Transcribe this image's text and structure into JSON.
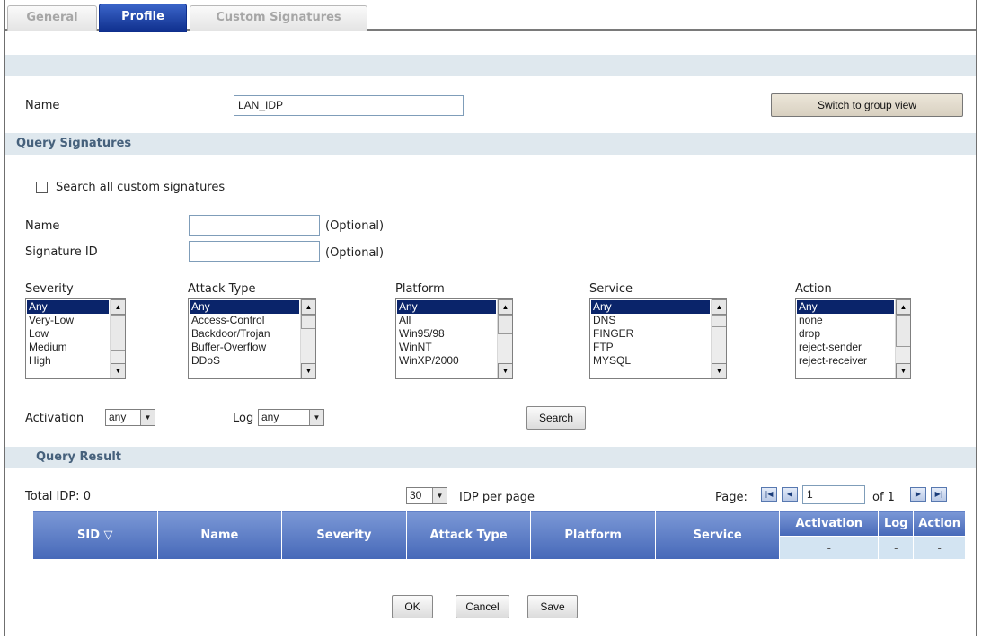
{
  "tabs": [
    {
      "label": "General"
    },
    {
      "label": "Profile"
    },
    {
      "label": "Custom Signatures"
    }
  ],
  "profile": {
    "name_label": "Name",
    "name_value": "LAN_IDP",
    "switch_button": "Switch to group view"
  },
  "query": {
    "header": "Query Signatures",
    "search_all_label": "Search all custom signatures",
    "name_label": "Name",
    "name_optional": "(Optional)",
    "sigid_label": "Signature ID",
    "sigid_optional": "(Optional)",
    "severity": {
      "label": "Severity",
      "options": [
        "Any",
        "Very-Low",
        "Low",
        "Medium",
        "High"
      ]
    },
    "attack_type": {
      "label": "Attack Type",
      "options": [
        "Any",
        "Access-Control",
        "Backdoor/Trojan",
        "Buffer-Overflow",
        "DDoS"
      ]
    },
    "platform": {
      "label": "Platform",
      "options": [
        "Any",
        "All",
        "Win95/98",
        "WinNT",
        "WinXP/2000"
      ]
    },
    "service": {
      "label": "Service",
      "options": [
        "Any",
        "DNS",
        "FINGER",
        "FTP",
        "MYSQL"
      ]
    },
    "action": {
      "label": "Action",
      "options": [
        "Any",
        "none",
        "drop",
        "reject-sender",
        "reject-receiver"
      ]
    },
    "activation_label": "Activation",
    "activation_value": "any",
    "log_label": "Log",
    "log_value": "any",
    "search_button": "Search"
  },
  "result": {
    "header": "Query Result",
    "total": "Total IDP: 0",
    "per_page_value": "30",
    "per_page_label": "IDP per page",
    "page_label": "Page:",
    "page_value": "1",
    "of_label": "of 1",
    "columns": [
      "SID",
      "Name",
      "Severity",
      "Attack Type",
      "Platform",
      "Service",
      "Activation",
      "Log",
      "Action"
    ],
    "row": [
      "-",
      "-",
      "-"
    ]
  },
  "footer": {
    "ok": "OK",
    "cancel": "Cancel",
    "save": "Save"
  }
}
